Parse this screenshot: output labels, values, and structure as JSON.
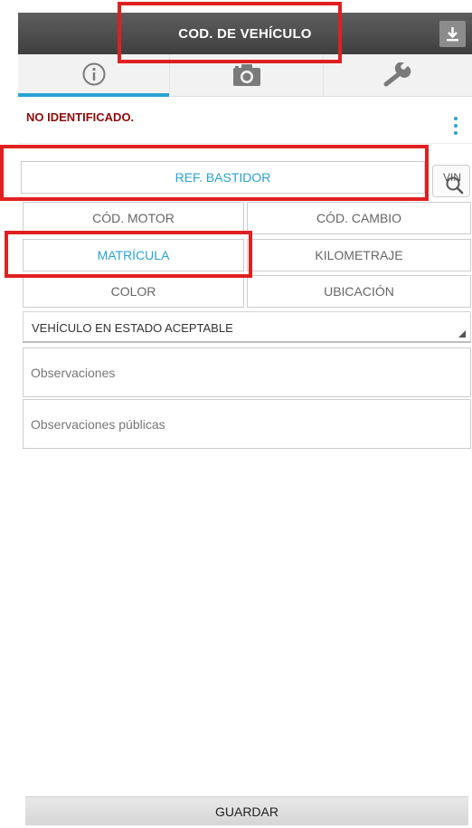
{
  "header": {
    "title": "COD. DE VEHÍCULO",
    "download_icon": "download-icon"
  },
  "tabs": [
    {
      "icon": "info-icon",
      "active": true
    },
    {
      "icon": "camera-icon",
      "active": false
    },
    {
      "icon": "wrench-icon",
      "active": false
    }
  ],
  "status": {
    "text": "NO IDENTIFICADO.",
    "menu_icon": "more-vert-icon"
  },
  "fields": {
    "ref_bastidor": "REF. BASTIDOR",
    "cod_motor": "CÓD. MOTOR",
    "cod_cambio": "CÓD. CAMBIO",
    "matricula": "MATRÍCULA",
    "kilometraje": "KILOMETRAJE",
    "color": "COLOR",
    "ubicacion": "UBICACIÓN"
  },
  "vin_search": {
    "label": "VIN",
    "icon": "vin-search-icon"
  },
  "estado_select": {
    "selected": "VEHÍCULO EN ESTADO ACEPTABLE"
  },
  "observaciones": {
    "placeholder": "Observaciones"
  },
  "observaciones_publicas": {
    "placeholder": "Observaciones públicas"
  },
  "save_button": {
    "label": "GUARDAR"
  },
  "colors": {
    "accent": "#2aa3d4",
    "status_text": "#8e0b0b",
    "annotation": "#e02020",
    "topbar": "#4a4a4a"
  }
}
